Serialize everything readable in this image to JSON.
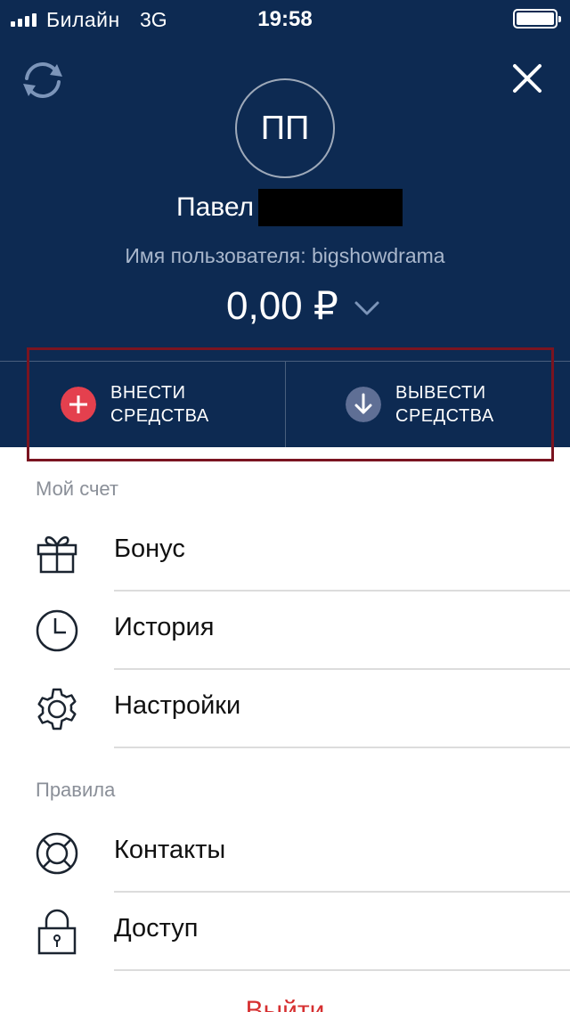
{
  "status_bar": {
    "carrier": "Билайн",
    "network": "3G",
    "time": "19:58"
  },
  "header": {
    "refresh_icon": "refresh-icon",
    "close_icon": "close-icon",
    "avatar_initials": "ПП",
    "user_name": "Павел",
    "username_line": "Имя пользователя: bigshowdrama",
    "balance": "0,00 ₽"
  },
  "actions": {
    "deposit_line1": "ВНЕСТИ",
    "deposit_line2": "СРЕДСТВА",
    "withdraw_line1": "ВЫВЕСТИ",
    "withdraw_line2": "СРЕДСТВА"
  },
  "colors": {
    "header_bg": "#0d2a52",
    "deposit_icon": "#e4404e",
    "withdraw_icon": "#5f6f95",
    "highlight_border": "#7a1420",
    "logout": "#d63031"
  },
  "menu": {
    "section_account": "Мой счет",
    "items_account": [
      {
        "label": "Бонус",
        "icon": "gift-icon"
      },
      {
        "label": "История",
        "icon": "clock-icon"
      },
      {
        "label": "Настройки",
        "icon": "gear-icon"
      }
    ],
    "section_rules": "Правила",
    "items_rules": [
      {
        "label": "Контакты",
        "icon": "lifebuoy-icon"
      },
      {
        "label": "Доступ",
        "icon": "lock-icon"
      }
    ],
    "logout": "Выйти"
  }
}
